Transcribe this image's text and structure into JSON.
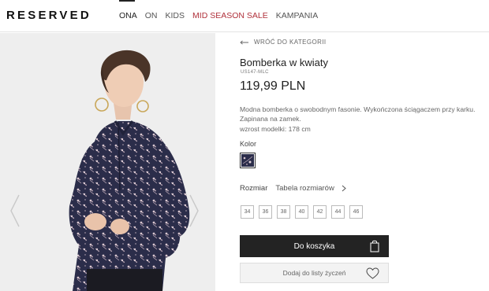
{
  "header": {
    "logo": "RESERVED",
    "nav": [
      {
        "label": "ONA"
      },
      {
        "label": "ON"
      },
      {
        "label": "KIDS"
      },
      {
        "label": "MID SEASON SALE"
      },
      {
        "label": "KAMPANIA"
      }
    ]
  },
  "product": {
    "back_label": "WRÓĆ DO KATEGORII",
    "title": "Bomberka w kwiaty",
    "sku": "US147-MLC",
    "price": "119,99 PLN",
    "description_lines": [
      "Modna bomberka o swobodnym fasonie. Wykończona ściągaczem przy karku.",
      "Zapinana na zamek.",
      "wzrost modelki: 178 cm"
    ],
    "color_label": "Kolor",
    "size_label": "Rozmiar",
    "size_table_label": "Tabela rozmiarów",
    "sizes": [
      "34",
      "36",
      "38",
      "40",
      "42",
      "44",
      "46"
    ],
    "add_to_cart_label": "Do koszyka",
    "wishlist_label": "Dodaj do listy życzeń"
  },
  "colors": {
    "sale": "#b0303a",
    "button_dark": "#232323",
    "swatch": "#2b2d4a"
  },
  "icons": {
    "back": "arrow-left-icon",
    "size_table": "chevron-right-icon",
    "cart": "shopping-bag-icon",
    "wishlist": "heart-icon",
    "gallery_prev": "chevron-left-icon",
    "gallery_next": "chevron-right-icon"
  }
}
